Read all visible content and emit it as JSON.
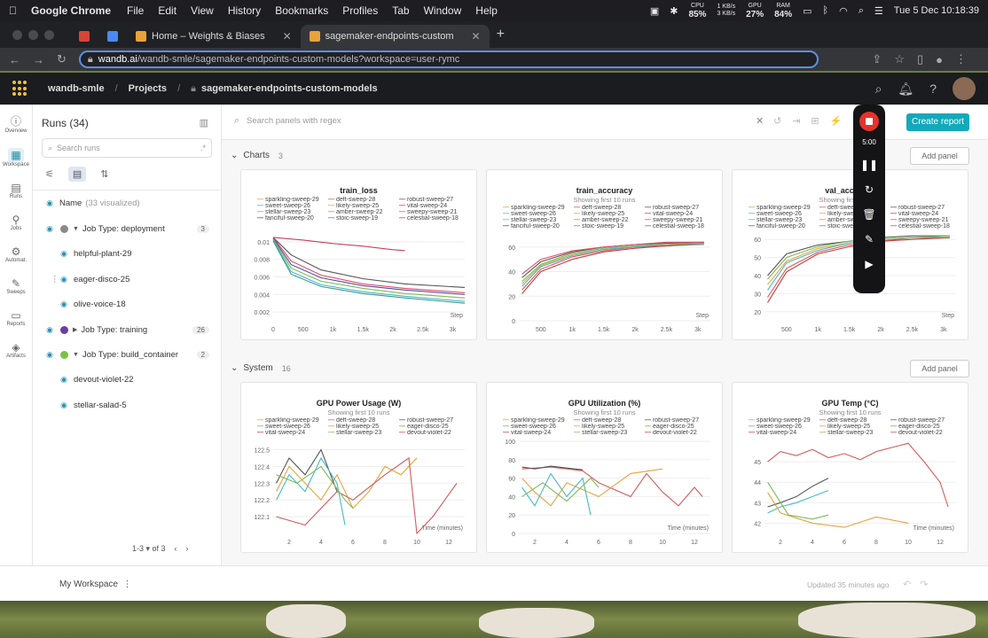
{
  "mac": {
    "app": "Google Chrome",
    "menus": [
      "File",
      "Edit",
      "View",
      "History",
      "Bookmarks",
      "Profiles",
      "Tab",
      "Window",
      "Help"
    ],
    "cpu": "85%",
    "net_up": "1 KB/s",
    "net_down": "3 KB/s",
    "gpu": "27%",
    "ram": "84%",
    "datetime": "Tue 5 Dec  10:18:39"
  },
  "browser": {
    "tabs": [
      {
        "label": "Home – Weights & Biases"
      },
      {
        "label": "sagemaker-endpoints-custom"
      }
    ],
    "url_host": "wandb.ai",
    "url_path": "/wandb-smle/sagemaker-endpoints-custom-models?workspace=user-rymc"
  },
  "header": {
    "entity": "wandb-smle",
    "projects": "Projects",
    "project": "sagemaker-endpoints-custom-models"
  },
  "leftnav": [
    "Overview",
    "Workspace",
    "Runs",
    "Jobs",
    "Automat.",
    "Sweeps",
    "Reports",
    "Artifacts"
  ],
  "runs": {
    "title": "Runs (34)",
    "search_placeholder": "Search runs",
    "name_col": "Name",
    "visualized": "(33 visualized)",
    "groups": [
      {
        "label": "Job Type: deployment",
        "count": "3",
        "color": "#8a8a8a",
        "expanded": true,
        "children": [
          "helpful-plant-29",
          "eager-disco-25",
          "olive-voice-18"
        ]
      },
      {
        "label": "Job Type: training",
        "count": "26",
        "color": "#6a3fa0",
        "expanded": false,
        "children": []
      },
      {
        "label": "Job Type: build_container",
        "count": "2",
        "color": "#7cc242",
        "expanded": true,
        "children": [
          "devout-violet-22",
          "stellar-salad-5"
        ]
      }
    ],
    "pager": "1-3 ▾   of 3"
  },
  "main": {
    "panel_search_placeholder": "Search panels with regex",
    "create_report": "Create report",
    "add_panel": "Add panel",
    "charts_section": {
      "label": "Charts",
      "count": "3"
    },
    "system_section": {
      "label": "System",
      "count": "16"
    }
  },
  "legend_train": [
    {
      "name": "sparkling-sweep-29",
      "color": "#e8a33b"
    },
    {
      "name": "deft-sweep-28",
      "color": "#d35b5b"
    },
    {
      "name": "robust-sweep-27",
      "color": "#555555"
    },
    {
      "name": "sweet-sweep-26",
      "color": "#46b8c9"
    },
    {
      "name": "likely-sweep-25",
      "color": "#f09a3a"
    },
    {
      "name": "vital-sweep-24",
      "color": "#c83a3a"
    },
    {
      "name": "stellar-sweep-23",
      "color": "#7dba58"
    },
    {
      "name": "amber-sweep-22",
      "color": "#d4883a"
    },
    {
      "name": "sweepy-sweep-21",
      "color": "#e04a6a"
    },
    {
      "name": "fanciful-sweep-20",
      "color": "#5a4aa0"
    },
    {
      "name": "stoic-sweep-19",
      "color": "#3a9a8a"
    },
    {
      "name": "celestial-sweep-18",
      "color": "#c8405a"
    }
  ],
  "legend_sys": [
    {
      "name": "sparkling-sweep-29",
      "color": "#e8a33b"
    },
    {
      "name": "deft-sweep-28",
      "color": "#d35b5b"
    },
    {
      "name": "robust-sweep-27",
      "color": "#555555"
    },
    {
      "name": "sweet-sweep-26",
      "color": "#46b8c9"
    },
    {
      "name": "likely-sweep-25",
      "color": "#f09a3a"
    },
    {
      "name": "eager-disco-25",
      "color": "#d4883a"
    },
    {
      "name": "vital-sweep-24",
      "color": "#c83a3a"
    },
    {
      "name": "stellar-sweep-23",
      "color": "#7dba58"
    },
    {
      "name": "devout-violet-22",
      "color": "#c8405a"
    }
  ],
  "chart_data": [
    {
      "type": "line",
      "title": "train_loss",
      "subtitle": "",
      "xlabel": "Step",
      "xticks": [
        "0",
        "500",
        "1k",
        "1.5k",
        "2k",
        "2.5k",
        "3k"
      ],
      "yticks": [
        "0.01",
        "0.008",
        "0.006",
        "0.004",
        "0.002"
      ],
      "xlim": [
        0,
        3200
      ],
      "ylim": [
        0.001,
        0.0115
      ],
      "series": [
        {
          "name": "celestial-sweep-18",
          "color": "#c8405a",
          "x": [
            0,
            500,
            1000,
            1500,
            2000,
            2200
          ],
          "y": [
            0.0105,
            0.0102,
            0.0098,
            0.0095,
            0.0091,
            0.009
          ]
        },
        {
          "name": "robust-sweep-27",
          "color": "#555555",
          "x": [
            0,
            300,
            800,
            1500,
            2200,
            3200
          ],
          "y": [
            0.0105,
            0.0085,
            0.0068,
            0.0058,
            0.0052,
            0.0048
          ]
        },
        {
          "name": "sweepy-sweep-21",
          "color": "#e04a6a",
          "x": [
            0,
            300,
            800,
            1500,
            2200,
            3200
          ],
          "y": [
            0.0105,
            0.0078,
            0.0062,
            0.0052,
            0.0047,
            0.0042
          ]
        },
        {
          "name": "fanciful-sweep-20",
          "color": "#5a4aa0",
          "x": [
            0,
            300,
            800,
            1500,
            2200,
            3200
          ],
          "y": [
            0.0104,
            0.0074,
            0.0059,
            0.005,
            0.0045,
            0.004
          ]
        },
        {
          "name": "stellar-sweep-23",
          "color": "#7dba58",
          "x": [
            0,
            300,
            800,
            1500,
            2200,
            3200
          ],
          "y": [
            0.0103,
            0.007,
            0.0055,
            0.0047,
            0.0041,
            0.0036
          ]
        },
        {
          "name": "sweet-sweep-26",
          "color": "#46b8c9",
          "x": [
            0,
            300,
            800,
            1500,
            2200,
            3200
          ],
          "y": [
            0.0102,
            0.0066,
            0.0051,
            0.0043,
            0.0038,
            0.0032
          ]
        },
        {
          "name": "stoic-sweep-19",
          "color": "#3a9a8a",
          "x": [
            0,
            300,
            800,
            1500,
            2200,
            3200
          ],
          "y": [
            0.0101,
            0.0063,
            0.0049,
            0.0041,
            0.0036,
            0.003
          ]
        }
      ]
    },
    {
      "type": "line",
      "title": "train_accuracy",
      "subtitle": "Showing first 10 runs",
      "xlabel": "Step",
      "xticks": [
        "500",
        "1k",
        "1.5k",
        "2k",
        "2.5k",
        "3k"
      ],
      "yticks": [
        "60",
        "40",
        "20",
        "0"
      ],
      "xlim": [
        150,
        3200
      ],
      "ylim": [
        0,
        75
      ],
      "series": [
        {
          "name": "sparkling-sweep-29",
          "color": "#e8a33b",
          "x": [
            200,
            500,
            1000,
            1500,
            2000,
            2500,
            3100
          ],
          "y": [
            30,
            45,
            54,
            58,
            61,
            62,
            63
          ]
        },
        {
          "name": "deft-sweep-28",
          "color": "#d35b5b",
          "x": [
            200,
            500,
            1000,
            1500,
            2000,
            2500,
            3100
          ],
          "y": [
            25,
            42,
            52,
            57,
            60,
            62,
            62
          ]
        },
        {
          "name": "robust-sweep-27",
          "color": "#555555",
          "x": [
            200,
            500,
            1000,
            1500,
            2000,
            2500,
            3100
          ],
          "y": [
            35,
            48,
            56,
            60,
            62,
            63,
            64
          ]
        },
        {
          "name": "sweet-sweep-26",
          "color": "#46b8c9",
          "x": [
            200,
            500,
            1000,
            1500,
            2000,
            2500,
            3100
          ],
          "y": [
            28,
            44,
            53,
            58,
            60,
            61,
            62
          ]
        },
        {
          "name": "vital-sweep-24",
          "color": "#c83a3a",
          "x": [
            200,
            500,
            1000,
            1500,
            2000,
            2500,
            3100
          ],
          "y": [
            22,
            40,
            50,
            56,
            59,
            61,
            63
          ]
        },
        {
          "name": "stellar-sweep-23",
          "color": "#7dba58",
          "x": [
            200,
            500,
            1000,
            1500,
            2000,
            2500,
            3100
          ],
          "y": [
            32,
            46,
            55,
            59,
            61,
            62,
            63
          ]
        },
        {
          "name": "sweepy-sweep-21",
          "color": "#e04a6a",
          "x": [
            200,
            500,
            1000,
            1500,
            2000,
            2500,
            3100
          ],
          "y": [
            38,
            50,
            57,
            60,
            62,
            64,
            64
          ]
        }
      ]
    },
    {
      "type": "line",
      "title": "val_accuracy",
      "subtitle": "Showing first 10 runs",
      "xlabel": "Step",
      "xticks": [
        "500",
        "1k",
        "1.5k",
        "2k",
        "2.5k",
        "3k"
      ],
      "yticks": [
        "60",
        "50",
        "40",
        "30",
        "20"
      ],
      "xlim": [
        150,
        3200
      ],
      "ylim": [
        15,
        66
      ],
      "series": [
        {
          "name": "sparkling-sweep-29",
          "color": "#e8a33b",
          "x": [
            200,
            500,
            1000,
            1500,
            2000,
            2500,
            3100
          ],
          "y": [
            35,
            48,
            55,
            58,
            60,
            61,
            61
          ]
        },
        {
          "name": "deft-sweep-28",
          "color": "#d35b5b",
          "x": [
            200,
            500,
            1000,
            1500,
            2000,
            2500,
            3100
          ],
          "y": [
            28,
            44,
            53,
            57,
            59,
            61,
            61
          ]
        },
        {
          "name": "robust-sweep-27",
          "color": "#555555",
          "x": [
            200,
            500,
            1000,
            1500,
            2000,
            2500,
            3100
          ],
          "y": [
            40,
            52,
            57,
            59,
            61,
            62,
            62
          ]
        },
        {
          "name": "sweet-sweep-26",
          "color": "#46b8c9",
          "x": [
            200,
            500,
            1000,
            1500,
            2000,
            2500,
            3100
          ],
          "y": [
            32,
            47,
            54,
            58,
            60,
            61,
            61
          ]
        },
        {
          "name": "vital-sweep-24",
          "color": "#c83a3a",
          "x": [
            200,
            500,
            1000,
            1500,
            2000,
            2500,
            3100
          ],
          "y": [
            25,
            42,
            52,
            56,
            59,
            60,
            61
          ]
        },
        {
          "name": "stellar-sweep-23",
          "color": "#7dba58",
          "x": [
            200,
            500,
            1000,
            1500,
            2000,
            2500,
            3100
          ],
          "y": [
            38,
            50,
            56,
            59,
            60,
            61,
            62
          ]
        }
      ]
    },
    {
      "type": "line",
      "title": "GPU Power Usage (W)",
      "subtitle": "Showing first 10 runs",
      "xlabel": "Time (minutes)",
      "xticks": [
        "2",
        "4",
        "6",
        "8",
        "10",
        "12"
      ],
      "yticks": [
        "122.5",
        "122.4",
        "122.3",
        "122.2",
        "122.1"
      ],
      "xlim": [
        1,
        13
      ],
      "ylim": [
        122.0,
        122.55
      ],
      "series": [
        {
          "name": "sparkling-sweep-29",
          "color": "#e8a33b",
          "x": [
            1.2,
            2,
            3,
            4,
            5,
            6,
            7,
            8,
            9,
            10
          ],
          "y": [
            122.25,
            122.4,
            122.3,
            122.2,
            122.35,
            122.15,
            122.25,
            122.4,
            122.35,
            122.45
          ]
        },
        {
          "name": "deft-sweep-28",
          "color": "#d35b5b",
          "x": [
            1.2,
            3,
            5,
            6,
            8,
            9.5,
            10,
            11,
            12.5
          ],
          "y": [
            122.1,
            122.05,
            122.25,
            122.2,
            122.35,
            122.45,
            122.0,
            122.1,
            122.3
          ]
        },
        {
          "name": "robust-sweep-27",
          "color": "#555555",
          "x": [
            1.2,
            2,
            3,
            4,
            5
          ],
          "y": [
            122.3,
            122.45,
            122.35,
            122.5,
            122.25
          ]
        },
        {
          "name": "sweet-sweep-26",
          "color": "#46b8c9",
          "x": [
            1.2,
            2,
            3,
            4,
            5,
            5.5
          ],
          "y": [
            122.2,
            122.35,
            122.25,
            122.45,
            122.3,
            122.05
          ]
        },
        {
          "name": "stellar-sweep-23",
          "color": "#7dba58",
          "x": [
            1.2,
            2.5,
            4,
            5.5,
            6
          ],
          "y": [
            122.35,
            122.3,
            122.4,
            122.2,
            122.15
          ]
        }
      ]
    },
    {
      "type": "line",
      "title": "GPU Utilization (%)",
      "subtitle": "Showing first 10 runs",
      "xlabel": "Time (minutes)",
      "xticks": [
        "2",
        "4",
        "6",
        "8",
        "10",
        "12"
      ],
      "yticks": [
        "100",
        "80",
        "60",
        "40",
        "20",
        "0"
      ],
      "xlim": [
        1,
        13
      ],
      "ylim": [
        0,
        100
      ],
      "series": [
        {
          "name": "deft-sweep-28",
          "color": "#d35b5b",
          "x": [
            1.2,
            3,
            5,
            6,
            8,
            9,
            10,
            11,
            12,
            12.5
          ],
          "y": [
            70,
            72,
            68,
            55,
            40,
            65,
            45,
            30,
            50,
            40
          ]
        },
        {
          "name": "robust-sweep-27",
          "color": "#555555",
          "x": [
            1.2,
            2,
            3,
            4,
            5
          ],
          "y": [
            72,
            70,
            73,
            71,
            69
          ]
        },
        {
          "name": "sparkling-sweep-29",
          "color": "#e8a33b",
          "x": [
            1.2,
            2,
            3,
            4,
            6,
            8,
            10
          ],
          "y": [
            60,
            45,
            30,
            55,
            40,
            65,
            70
          ]
        },
        {
          "name": "sweet-sweep-26",
          "color": "#46b8c9",
          "x": [
            1.2,
            2,
            3,
            4,
            5,
            5.5
          ],
          "y": [
            50,
            30,
            65,
            40,
            60,
            20
          ]
        },
        {
          "name": "stellar-sweep-23",
          "color": "#7dba58",
          "x": [
            1.2,
            2.5,
            4,
            5.5,
            6
          ],
          "y": [
            40,
            55,
            35,
            60,
            50
          ]
        }
      ]
    },
    {
      "type": "line",
      "title": "GPU Temp (°C)",
      "subtitle": "Showing first 10 runs",
      "xlabel": "Time (minutes)",
      "xticks": [
        "2",
        "4",
        "6",
        "8",
        "10",
        "12"
      ],
      "yticks": [
        "45",
        "44",
        "43",
        "42"
      ],
      "xlim": [
        1,
        13
      ],
      "ylim": [
        41.5,
        46
      ],
      "series": [
        {
          "name": "deft-sweep-28",
          "color": "#d35b5b",
          "x": [
            1.2,
            2,
            3,
            4,
            5,
            6,
            7,
            8,
            9,
            10,
            11,
            12,
            12.5
          ],
          "y": [
            45,
            45.5,
            45.3,
            45.6,
            45.2,
            45.4,
            45.1,
            45.5,
            45.7,
            45.9,
            45.0,
            44.0,
            42.8
          ]
        },
        {
          "name": "robust-sweep-27",
          "color": "#555555",
          "x": [
            1.2,
            2,
            3,
            4,
            5
          ],
          "y": [
            42.8,
            43.0,
            43.3,
            43.8,
            44.2
          ]
        },
        {
          "name": "sweet-sweep-26",
          "color": "#46b8c9",
          "x": [
            1.2,
            2,
            3,
            4,
            5
          ],
          "y": [
            42.5,
            42.8,
            43.0,
            43.3,
            43.6
          ]
        },
        {
          "name": "sparkling-sweep-29",
          "color": "#e8a33b",
          "x": [
            1.2,
            2,
            4,
            6,
            8,
            10
          ],
          "y": [
            43.5,
            42.5,
            42.0,
            41.8,
            42.3,
            42.0
          ]
        },
        {
          "name": "stellar-sweep-23",
          "color": "#7dba58",
          "x": [
            1.2,
            2.5,
            4,
            5
          ],
          "y": [
            44.0,
            42.4,
            42.2,
            42.4
          ]
        }
      ]
    }
  ],
  "footer": {
    "workspace": "My Workspace",
    "updated": "Updated 35 minutes ago"
  },
  "recorder": {
    "time": "5:00"
  }
}
